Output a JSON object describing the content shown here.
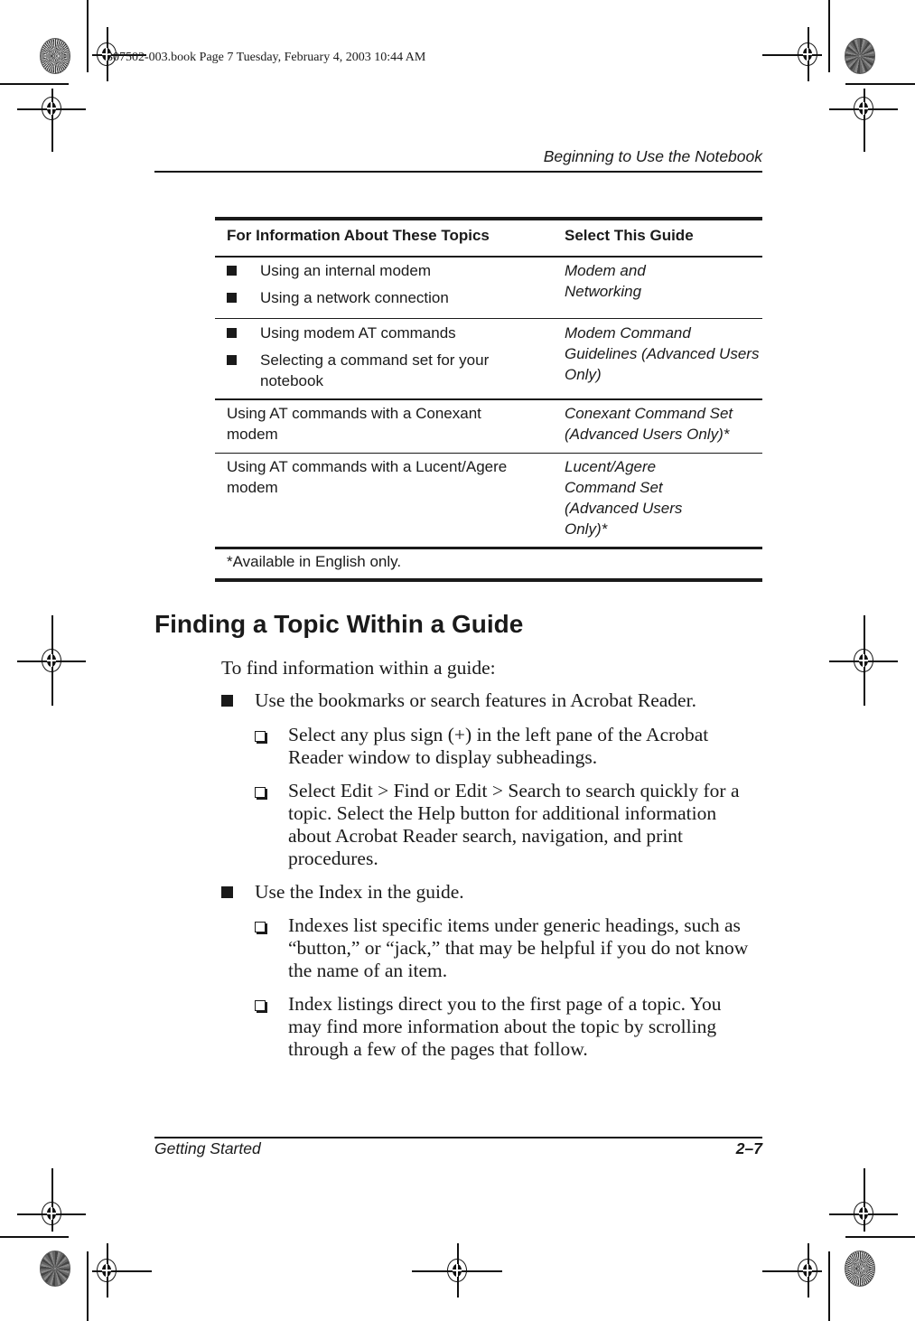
{
  "slug": "307502-003.book  Page 7  Tuesday, February 4, 2003  10:44 AM",
  "running_head": "Beginning to Use the Notebook",
  "table": {
    "headers": [
      "For Information About These Topics",
      "Select This Guide"
    ],
    "rows": [
      {
        "topics": [
          "Using an internal modem",
          "Using a network connection"
        ],
        "guide": "Modem and Networking"
      },
      {
        "topics": [
          "Using modem AT commands",
          "Selecting a command set for your notebook"
        ],
        "guide": "Modem Command Guidelines (Advanced Users Only)"
      },
      {
        "topic_text": "Using AT commands with a Conexant modem",
        "guide": "Conexant Command Set (Advanced Users Only)*"
      },
      {
        "topic_text": "Using AT commands with a Lucent/Agere modem",
        "guide": "Lucent/Agere Command Set (Advanced Users Only)*"
      }
    ],
    "footnote": "*Available in English only."
  },
  "section": {
    "heading": "Finding a Topic Within a Guide",
    "intro": "To find information within a guide:",
    "items": [
      {
        "text": "Use the bookmarks or search features in Acrobat Reader.",
        "subitems": [
          "Select any plus sign (+) in the left pane of the Acrobat Reader window to display subheadings.",
          "Select Edit > Find or Edit > Search to search quickly for a topic. Select the Help button for additional information about Acrobat Reader search, navigation, and print procedures."
        ]
      },
      {
        "text": "Use the Index in the guide.",
        "subitems": [
          "Indexes list specific items under generic headings, such as “button,” or “jack,” that may be helpful if you do not know the name of an item.",
          "Index listings direct you to the first page of a topic. You may find more information about the topic by scrolling through a few of the pages that follow."
        ]
      }
    ]
  },
  "footer": {
    "left": "Getting Started",
    "right": "2–7"
  }
}
